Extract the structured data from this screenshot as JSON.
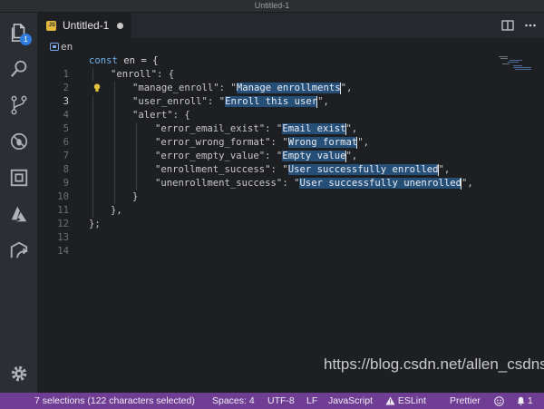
{
  "window": {
    "title": "Untitled-1"
  },
  "activity_bar": {
    "explorer_badge": "1"
  },
  "tab": {
    "label": "Untitled-1",
    "icon_text": "JS"
  },
  "breadcrumb": {
    "symbol": "en"
  },
  "editor": {
    "lines": [
      {
        "n": "1"
      },
      {
        "n": "2"
      },
      {
        "n": "3"
      },
      {
        "n": "4"
      },
      {
        "n": "5"
      },
      {
        "n": "6"
      },
      {
        "n": "7"
      },
      {
        "n": "8"
      },
      {
        "n": "9"
      },
      {
        "n": "10"
      },
      {
        "n": "11"
      },
      {
        "n": "12"
      },
      {
        "n": "13"
      },
      {
        "n": "14"
      }
    ],
    "code": {
      "l1_kw": "const",
      "l1_rest": " en = {",
      "l2": "\"enroll\": {",
      "l3_key": "\"manage_enroll\": \"",
      "l3_val": "Manage enrollments",
      "l3_end": "\",",
      "l4_key": "\"user_enroll\": \"",
      "l4_val": "Enroll this user",
      "l4_end": "\",",
      "l5": "\"alert\": {",
      "l6_key": "\"error_email_exist\": \"",
      "l6_val": "Email exist",
      "l6_end": "\",",
      "l7_key": "\"error_wrong_format\": \"",
      "l7_val": "Wrong format",
      "l7_end": "\",",
      "l8_key": "\"error_empty_value\": \"",
      "l8_val": "Empty value",
      "l8_end": "\",",
      "l9_key": "\"enrollment_success\": \"",
      "l9_val": "User successfully enrolled",
      "l9_end": "\",",
      "l10_key": "\"unenrollment_success\": \"",
      "l10_val": "User successfully unenrolled",
      "l10_end": "\",",
      "l11": "}",
      "l12": "},",
      "l13": "};"
    }
  },
  "watermark": "https://blog.csdn.net/allen_csdns",
  "status": {
    "selections": "7 selections (122 characters selected)",
    "spaces": "Spaces: 4",
    "encoding": "UTF-8",
    "eol": "LF",
    "language": "JavaScript",
    "eslint": "ESLint",
    "prettier": "Prettier",
    "notifications": "1"
  },
  "colors": {
    "status_bar": "#6f3d93",
    "selection": "#264f78",
    "keyword": "#6fb3e8",
    "badge": "#2f7de1"
  }
}
